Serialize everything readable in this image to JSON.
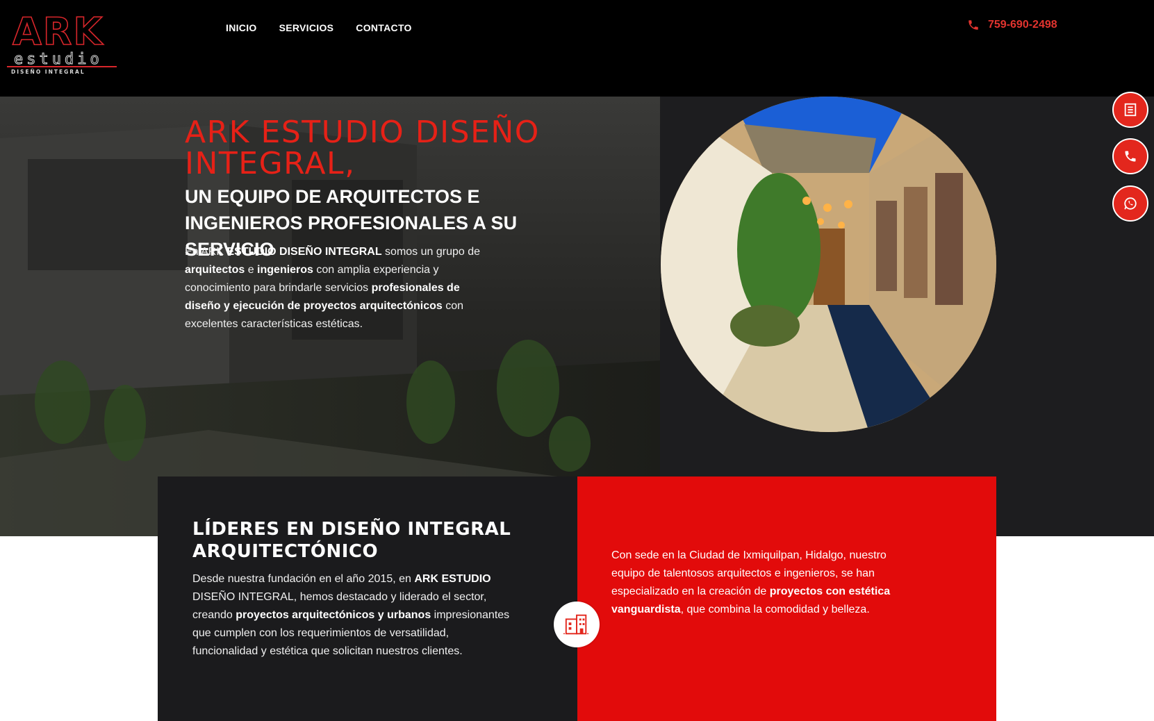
{
  "header": {
    "logo_text": "ARK",
    "logo_sub": "estudio",
    "logo_tag": "DISEÑO INTEGRAL",
    "nav": [
      "INICIO",
      "SERVICIOS",
      "CONTACTO"
    ],
    "phone": "759-690-2498",
    "phone_icon": "phone-icon"
  },
  "hero": {
    "title": "ARK ESTUDIO DISEÑO INTEGRAL,",
    "subtitle": "UN EQUIPO DE ARQUITECTOS E INGENIEROS PROFESIONALES A SU SERVICIO",
    "text": {
      "p1": "En ARK ",
      "b1": "ESTUDIO DISEÑO INTEGRAL",
      "p2": " somos un grupo de ",
      "b2": "arquitectos",
      "p3": " e ",
      "b3": "ingenieros",
      "p4": " con amplia experiencia y conocimiento para brindarle servicios ",
      "b4": "profesionales de diseño y ejecución de proyectos arquitectónicos",
      "p5": " con excelentes características estéticas."
    }
  },
  "floating_buttons": [
    "document-icon",
    "phone-icon",
    "whatsapp-icon"
  ],
  "leaders": {
    "title": "LÍDERES EN DISEÑO INTEGRAL ARQUITECTÓNICO",
    "p1": "Desde nuestra fundación en el año 2015, en ",
    "b1": "ARK ESTUDIO",
    "p2": " DISEÑO INTEGRAL, hemos destacado y liderado el sector, creando ",
    "b2": "proyectos arquitectónicos y urbanos",
    "p3": " impresionantes que cumplen con los requerimientos de versatilidad, funcionalidad y estética que solicitan nuestros clientes."
  },
  "sede": {
    "p1": "Con sede en la Ciudad de Ixmiquilpan, Hidalgo, nuestro equipo de talentosos arquitectos e ingenieros, se han especializado en la creación de ",
    "b1": "proyectos con estética vanguardista",
    "p2": ", que combina la comodidad y belleza."
  },
  "colors": {
    "accent": "#e3271d",
    "dark": "#1b1b1d",
    "red_panel": "#e20b0b"
  }
}
